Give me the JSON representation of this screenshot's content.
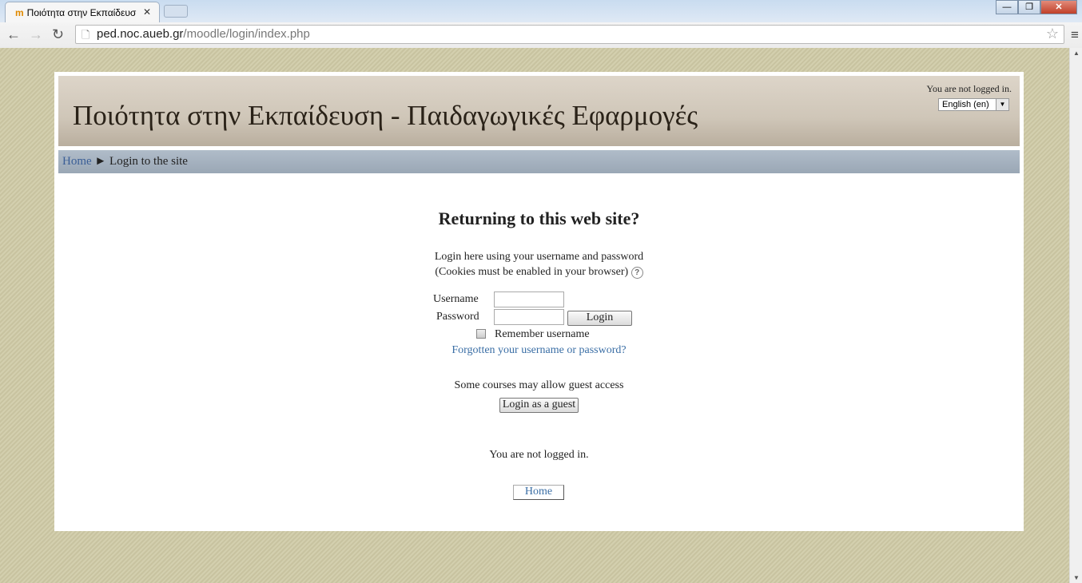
{
  "browser": {
    "tab_title": "Ποιότητα στην Εκπαίδευσ",
    "url_host": "ped.noc.aueb.gr",
    "url_path": "/moodle/login/index.php"
  },
  "header": {
    "site_title": "Ποιότητα στην Εκπαίδευση - Παιδαγωγικές Εφαρμογές",
    "login_info": "You are not logged in.",
    "language": "English (en)"
  },
  "breadcrumb": {
    "home": "Home",
    "separator": "►",
    "current": "Login to the site"
  },
  "login": {
    "heading": "Returning to this web site?",
    "intro1": "Login here using your username and password",
    "intro2": "(Cookies must be enabled in your browser)",
    "username_label": "Username",
    "password_label": "Password",
    "username_value": "",
    "password_value": "",
    "login_button": "Login",
    "remember_label": "Remember username",
    "remember_checked": false,
    "forgot_link": "Forgotten your username or password?",
    "guest_text": "Some courses may allow guest access",
    "guest_button": "Login as a guest"
  },
  "footer": {
    "login_info": "You are not logged in.",
    "home_button": "Home"
  }
}
